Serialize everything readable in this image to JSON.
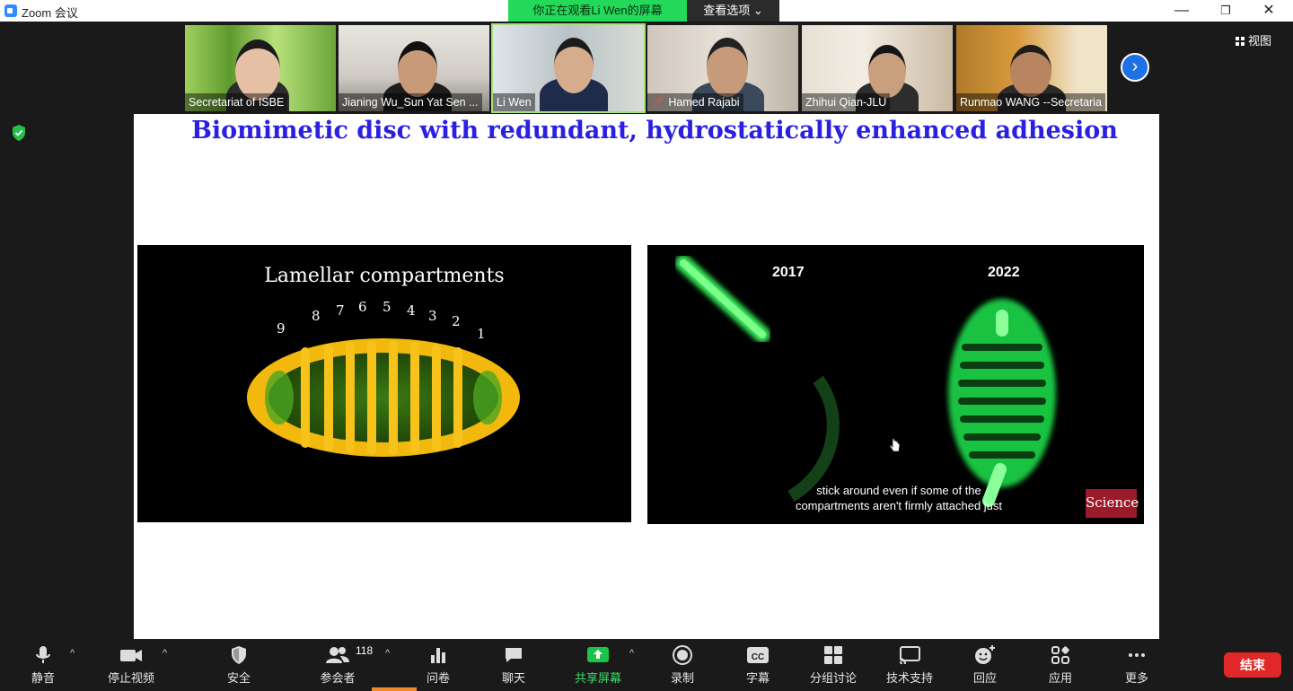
{
  "window": {
    "title": "Zoom 会议",
    "minimize": "—",
    "restore": "❐",
    "close": "✕"
  },
  "banner": {
    "viewing_text": "你正在观看Li Wen的屏幕",
    "options_label": "查看选项"
  },
  "gallery": {
    "participants": [
      {
        "name": "Secretariat of ISBE",
        "muted": false
      },
      {
        "name": "Jianing Wu_Sun Yat Sen ...",
        "muted": false
      },
      {
        "name": "Li Wen",
        "muted": false
      },
      {
        "name": "Hamed Rajabi",
        "muted": true
      },
      {
        "name": "Zhihui Qian-JLU",
        "muted": false
      },
      {
        "name": "Runmao WANG --Secretaria",
        "muted": false
      }
    ],
    "view_label": "视图"
  },
  "slide": {
    "title": "Biomimetic disc with redundant, hydrostatically enhanced adhesion",
    "left_panel": {
      "heading": "Lamellar compartments",
      "numbers": [
        "9",
        "8",
        "7",
        "6",
        "5",
        "4",
        "3",
        "2",
        "1"
      ]
    },
    "right_panel": {
      "year_left": "2017",
      "year_right": "2022",
      "caption_line1": "stick around even if some of the",
      "caption_line2": "compartments aren't firmly attached just",
      "logo_text": "Science"
    }
  },
  "toolbar": {
    "mute": "静音",
    "stop_video": "停止视频",
    "security": "安全",
    "participants": "参会者",
    "participant_count": "118",
    "polls": "问卷",
    "chat": "聊天",
    "share_screen": "共享屏幕",
    "record": "录制",
    "captions": "字幕",
    "breakout": "分组讨论",
    "tech_support": "技术支持",
    "reactions": "回应",
    "apps": "应用",
    "more": "更多",
    "end": "结束"
  },
  "colors": {
    "accent_blue": "#2d8cff",
    "banner_green": "#23d959",
    "share_green": "#1ec14a",
    "end_red": "#e02828",
    "slide_title": "#2a20e0"
  }
}
